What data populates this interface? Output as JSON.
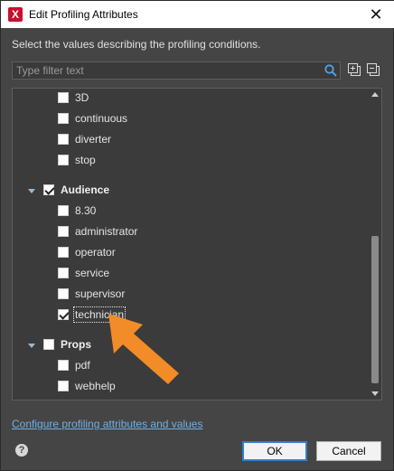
{
  "window": {
    "title": "Edit Profiling Attributes",
    "app_icon_letter": "X",
    "close_glyph": "✕"
  },
  "description": "Select the values describing the profiling conditions.",
  "filter": {
    "placeholder": "Type filter text",
    "value": ""
  },
  "toolbar": {
    "icons": [
      "search-icon",
      "expand-all-icon",
      "collapse-all-icon"
    ]
  },
  "tree": {
    "top_items": [
      {
        "label": "3D",
        "checked": false
      },
      {
        "label": "continuous",
        "checked": false
      },
      {
        "label": "diverter",
        "checked": false
      },
      {
        "label": "stop",
        "checked": false
      }
    ],
    "groups": [
      {
        "label": "Audience",
        "checked": true,
        "expanded": true,
        "items": [
          {
            "label": "8.30",
            "checked": false
          },
          {
            "label": "administrator",
            "checked": false
          },
          {
            "label": "operator",
            "checked": false
          },
          {
            "label": "service",
            "checked": false
          },
          {
            "label": "supervisor",
            "checked": false
          },
          {
            "label": "technician",
            "checked": true,
            "focused": true
          }
        ]
      },
      {
        "label": "Props",
        "checked": false,
        "expanded": true,
        "items": [
          {
            "label": "pdf",
            "checked": false
          },
          {
            "label": "webhelp",
            "checked": false
          }
        ]
      }
    ]
  },
  "footer": {
    "link": "Configure profiling attributes and values",
    "help_glyph": "?",
    "ok_label": "OK",
    "cancel_label": "Cancel"
  },
  "colors": {
    "accent": "#f28c28",
    "link": "#6fb0e8",
    "panel": "#454545"
  }
}
